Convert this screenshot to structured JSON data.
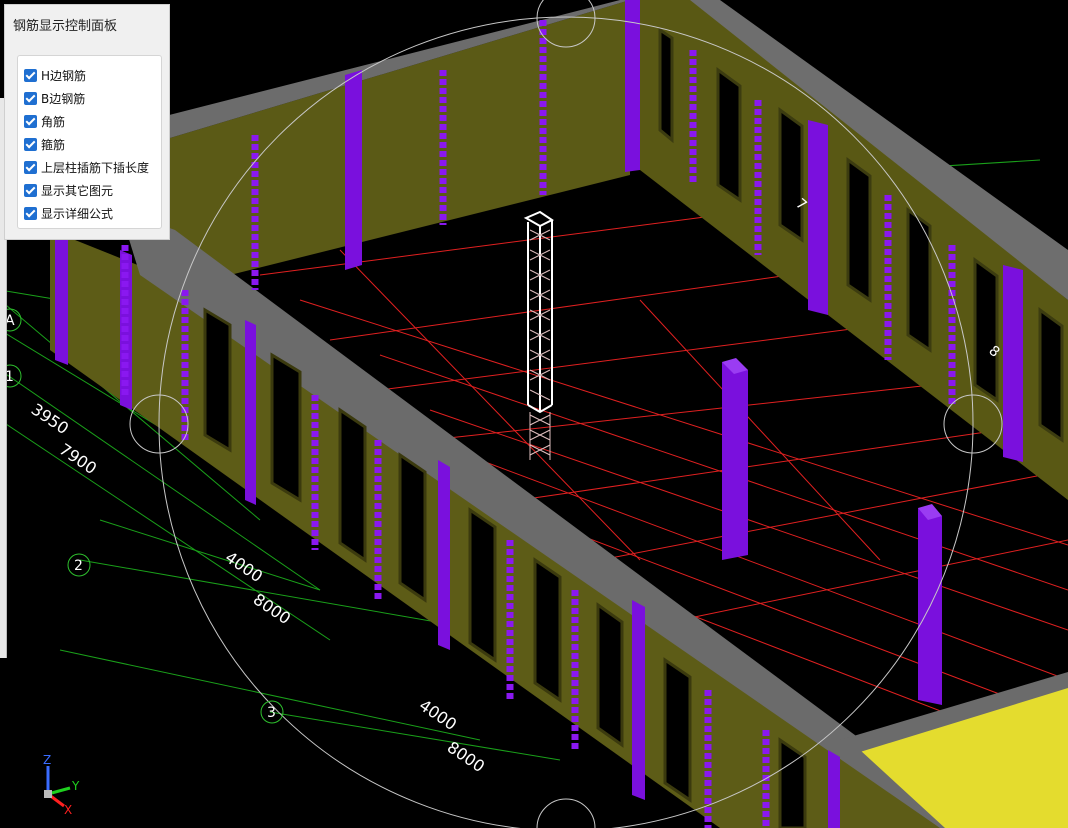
{
  "panel": {
    "title": "钢筋显示控制面板",
    "options": [
      {
        "label": "H边钢筋",
        "checked": true
      },
      {
        "label": "B边钢筋",
        "checked": true
      },
      {
        "label": "角筋",
        "checked": true
      },
      {
        "label": "箍筋",
        "checked": true
      },
      {
        "label": "上层柱插筋下插长度",
        "checked": true
      },
      {
        "label": "显示其它图元",
        "checked": true
      },
      {
        "label": "显示详细公式",
        "checked": true
      }
    ]
  },
  "axes": {
    "row_labels": [
      "A",
      "1",
      "2",
      "3"
    ],
    "right_labels": [
      "7",
      "8"
    ],
    "dimensions": [
      "3950",
      "7900",
      "4000",
      "8000",
      "4000",
      "8000"
    ]
  },
  "triad": {
    "z": "Z",
    "y": "Y",
    "x": "X"
  },
  "colors": {
    "wall": "#5f5e18",
    "column": "#7a0ddc",
    "beam": "#707070",
    "grid_red": "#ff2020",
    "grid_green": "#1fa81f",
    "slab": "#e6e030"
  }
}
